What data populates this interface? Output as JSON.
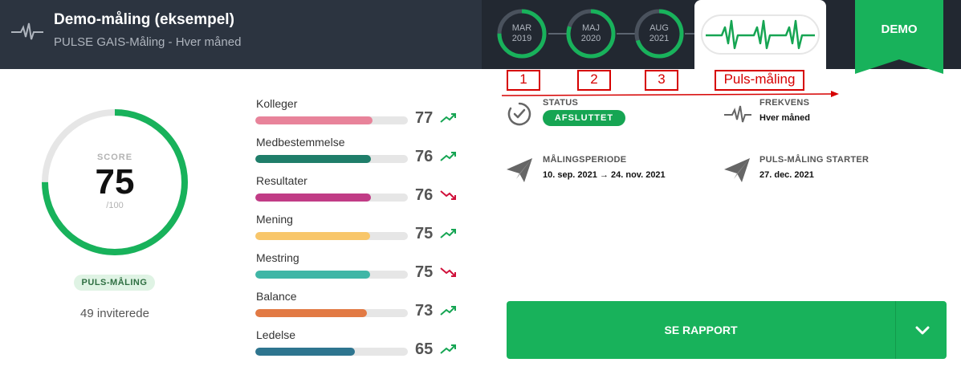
{
  "header": {
    "title": "Demo-måling (eksempel)",
    "subtitle": "PULSE GAIS-Måling - Hver måned",
    "demo_label": "DEMO",
    "rounds": [
      {
        "month": "MAR",
        "year": "2019",
        "progress": 0.75
      },
      {
        "month": "MAJ",
        "year": "2020",
        "progress": 0.8
      },
      {
        "month": "AUG",
        "year": "2021",
        "progress": 0.7
      }
    ],
    "pulse_icon": "heartbeat-icon"
  },
  "annotations": {
    "one": "1",
    "two": "2",
    "three": "3",
    "pulse": "Puls-måling"
  },
  "score": {
    "label": "SCORE",
    "value": "75",
    "max": "/100",
    "fraction": 0.75,
    "badge": "PULS-MÅLING",
    "invited": "49 inviterede"
  },
  "dimensions": [
    {
      "name": "Kolleger",
      "value": "77",
      "trend": "up",
      "color": "#e8839a"
    },
    {
      "name": "Medbestemmelse",
      "value": "76",
      "trend": "up",
      "color": "#1f7e6a"
    },
    {
      "name": "Resultater",
      "value": "76",
      "trend": "down",
      "color": "#c13c86"
    },
    {
      "name": "Mening",
      "value": "75",
      "trend": "up",
      "color": "#f8c66a"
    },
    {
      "name": "Mestring",
      "value": "75",
      "trend": "down",
      "color": "#3fb6a6"
    },
    {
      "name": "Balance",
      "value": "73",
      "trend": "up",
      "color": "#e27a44"
    },
    {
      "name": "Ledelse",
      "value": "65",
      "trend": "up",
      "color": "#2e758f"
    }
  ],
  "info": {
    "status_label": "STATUS",
    "status_value": "AFSLUTTET",
    "frequency_label": "FREKVENS",
    "frequency_value": "Hver måned",
    "period_label": "MÅLINGSPERIODE",
    "period_value": "10. sep. 2021 → 24. nov. 2021",
    "start_label": "PULS-MÅLING STARTER",
    "start_value": "27. dec. 2021"
  },
  "report_button": "SE RAPPORT",
  "colors": {
    "accent": "#18b25b",
    "header": "#2c3440",
    "trend_up": "#16a553",
    "trend_down": "#d0103a",
    "annotation": "#d60000"
  }
}
